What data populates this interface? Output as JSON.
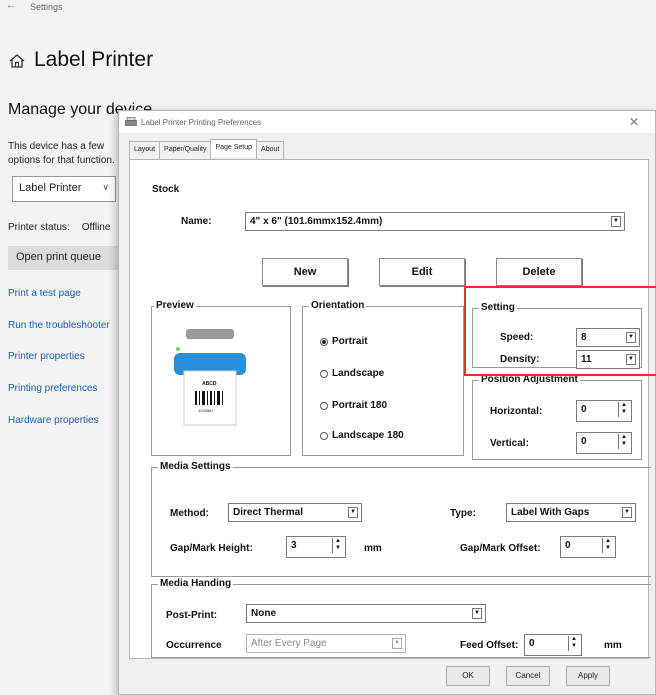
{
  "settings": {
    "breadcrumb": "Settings",
    "page_title": "Label Printer",
    "heading": "Manage your device",
    "description": "This device has a few options for that function.",
    "device_select": "Label Printer",
    "status_label": "Printer status:",
    "status_value": "Offline",
    "open_queue": "Open print queue",
    "links": [
      "Print a test page",
      "Run the troubleshooter",
      "Printer properties",
      "Printing preferences",
      "Hardware properties"
    ]
  },
  "dialog": {
    "title": "Label Printer Printing Preferences",
    "tabs": [
      "Layout",
      "Paper/Quality",
      "Page Setup",
      "About"
    ],
    "active_tab": "Page Setup",
    "stock": {
      "group": "Stock",
      "name_label": "Name:",
      "name_value": "4\" x 6\" (101.6mmx152.4mm)",
      "new": "New",
      "edit": "Edit",
      "delete": "Delete"
    },
    "preview": {
      "group": "Preview",
      "barcode_top": "ABCD",
      "barcode_number": "1234567"
    },
    "orientation": {
      "group": "Orientation",
      "options": [
        "Portrait",
        "Landscape",
        "Portrait 180",
        "Landscape 180"
      ],
      "selected": "Portrait"
    },
    "setting": {
      "group": "Setting",
      "speed_label": "Speed:",
      "speed_value": "8",
      "density_label": "Density:",
      "density_value": "11"
    },
    "position": {
      "group": "Position Adjustment",
      "horizontal_label": "Horizontal:",
      "horizontal_value": "0",
      "vertical_label": "Vertical:",
      "vertical_value": "0"
    },
    "media_settings": {
      "group": "Media Settings",
      "method_label": "Method:",
      "method_value": "Direct Thermal",
      "type_label": "Type:",
      "type_value": "Label With Gaps",
      "gap_height_label": "Gap/Mark Height:",
      "gap_height_value": "3",
      "gap_height_unit": "mm",
      "gap_offset_label": "Gap/Mark Offset:",
      "gap_offset_value": "0"
    },
    "media_handling": {
      "group": "Media Handing",
      "post_print_label": "Post-Print:",
      "post_print_value": "None",
      "occurrence_label": "Occurrence",
      "occurrence_value": "After Every Page",
      "feed_offset_label": "Feed Offset:",
      "feed_offset_value": "0",
      "feed_offset_unit": "mm"
    },
    "footer": {
      "ok": "OK",
      "cancel": "Cancel",
      "apply": "Apply"
    }
  },
  "colors": {
    "link": "#1a5fb4",
    "highlight": "#e0352b",
    "preview_blue": "#2a8fd8"
  }
}
